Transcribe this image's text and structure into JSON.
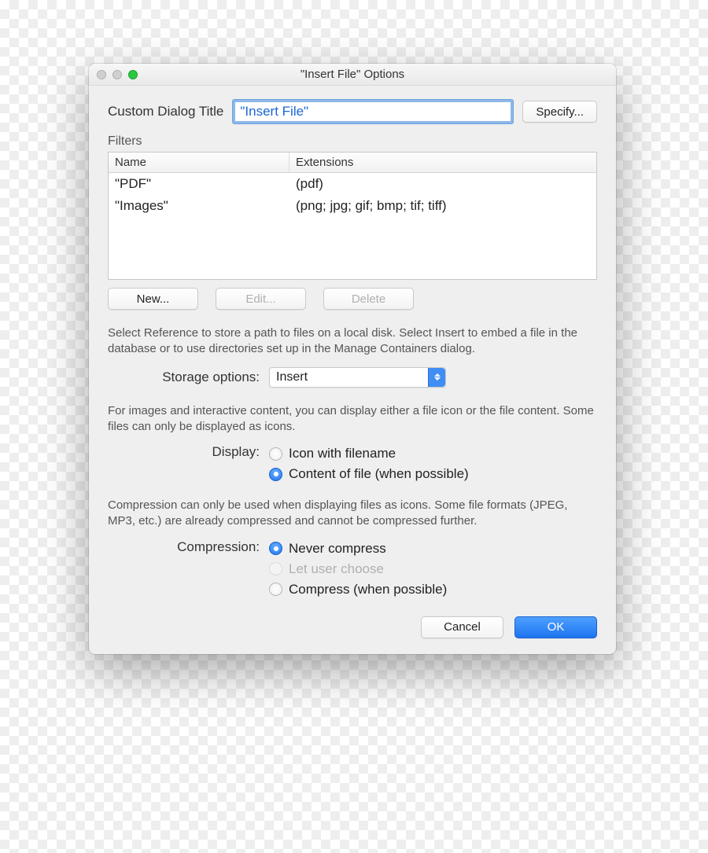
{
  "window": {
    "title": "\"Insert File\" Options"
  },
  "custom_title": {
    "label": "Custom Dialog Title",
    "value": "\"Insert File\"",
    "specify_btn": "Specify..."
  },
  "filters": {
    "section_label": "Filters",
    "columns": {
      "name": "Name",
      "ext": "Extensions"
    },
    "rows": [
      {
        "name": "\"PDF\"",
        "exts": "(pdf)"
      },
      {
        "name": "\"Images\"",
        "exts": "(png; jpg; gif; bmp; tif; tiff)"
      }
    ],
    "buttons": {
      "new": "New...",
      "edit": "Edit...",
      "delete": "Delete"
    }
  },
  "storage": {
    "help": "Select Reference to store a path to files on a local disk. Select Insert to embed a file in the database or to use directories set up in the Manage Containers dialog.",
    "label": "Storage options:",
    "value": "Insert"
  },
  "display": {
    "help": "For images and interactive content, you can display either a file icon or the file content. Some files can only be displayed as icons.",
    "label": "Display:",
    "options": {
      "icon": "Icon with filename",
      "content": "Content of file (when possible)"
    }
  },
  "compression": {
    "help": "Compression can only be used when displaying files as icons. Some file formats (JPEG, MP3, etc.) are already compressed and cannot be compressed further.",
    "label": "Compression:",
    "options": {
      "never": "Never compress",
      "let_user": "Let user choose",
      "compress": "Compress (when possible)"
    }
  },
  "footer": {
    "cancel": "Cancel",
    "ok": "OK"
  }
}
